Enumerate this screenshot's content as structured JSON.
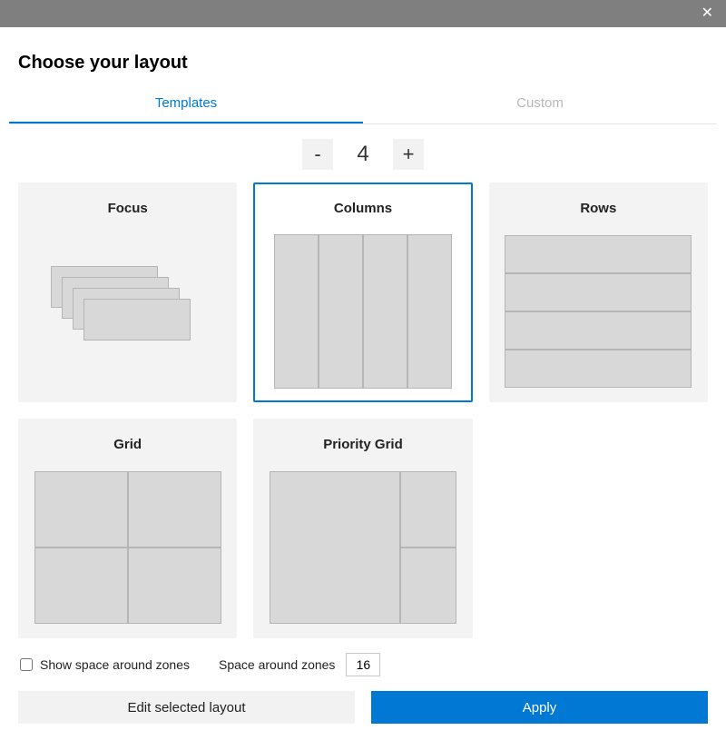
{
  "dialog": {
    "title": "Choose your layout",
    "close_label": "✕"
  },
  "tabs": {
    "templates": "Templates",
    "custom": "Custom",
    "active": "templates"
  },
  "count": {
    "value": "4",
    "minus": "-",
    "plus": "+"
  },
  "layouts": {
    "focus": "Focus",
    "columns": "Columns",
    "rows": "Rows",
    "grid": "Grid",
    "priority_grid": "Priority Grid",
    "selected": "columns"
  },
  "options": {
    "show_space_label": "Show space around zones",
    "show_space_checked": false,
    "space_label": "Space around zones",
    "space_value": "16"
  },
  "actions": {
    "edit": "Edit selected layout",
    "apply": "Apply"
  },
  "colors": {
    "accent": "#0078d4",
    "card_bg": "#f3f3f3",
    "preview_fill": "#d8d8d8",
    "preview_border": "#b5b5b5",
    "titlebar": "#7f7f7f"
  }
}
